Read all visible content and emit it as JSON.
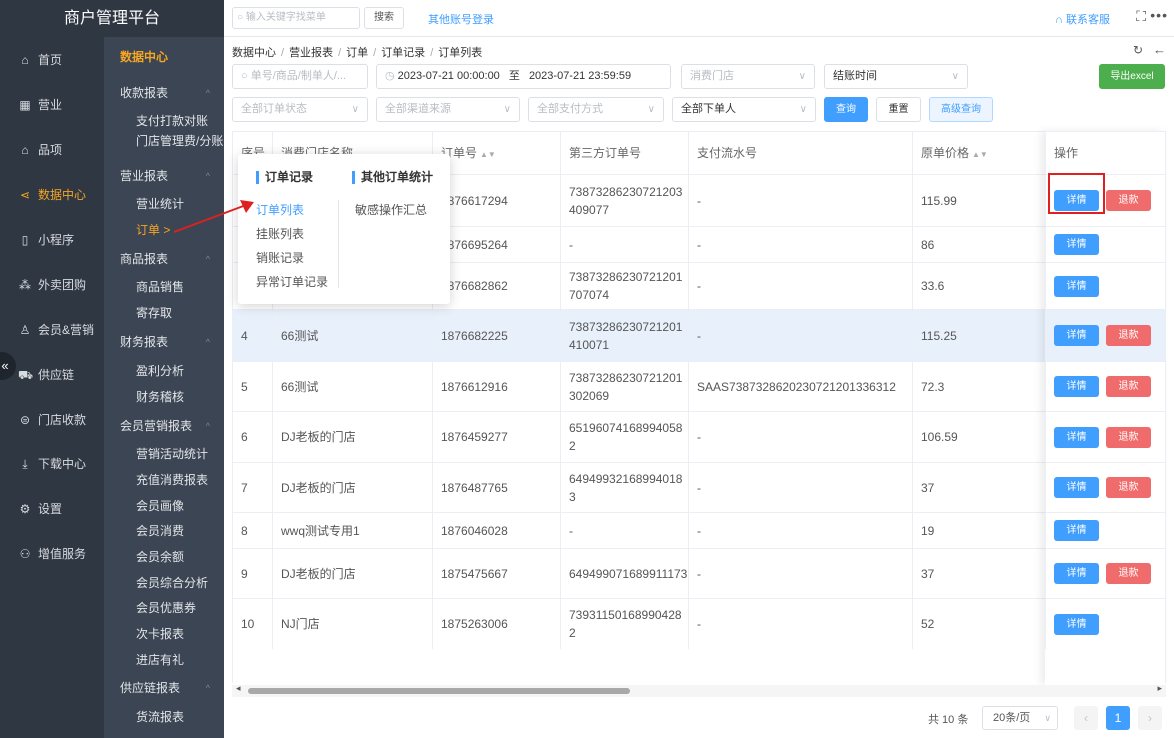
{
  "brand": "商户管理平台",
  "nav": [
    {
      "icon": "home-icon",
      "glyph": "⌂",
      "label": "首页"
    },
    {
      "icon": "calendar-icon",
      "glyph": "▦",
      "label": "营业"
    },
    {
      "icon": "bag-icon",
      "glyph": "⌂",
      "label": "品项"
    },
    {
      "icon": "share-icon",
      "glyph": "⋖",
      "label": "数据中心"
    },
    {
      "icon": "mobile-icon",
      "glyph": "▯",
      "label": "小程序"
    },
    {
      "icon": "group-icon",
      "glyph": "⁂",
      "label": "外卖团购"
    },
    {
      "icon": "user-icon",
      "glyph": "♙",
      "label": "会员&营销"
    },
    {
      "icon": "truck-icon",
      "glyph": "⛟",
      "label": "供应链"
    },
    {
      "icon": "wallet-icon",
      "glyph": "⊜",
      "label": "门店收款"
    },
    {
      "icon": "download-icon",
      "glyph": "⤓",
      "label": "下载中心"
    },
    {
      "icon": "gear-icon",
      "glyph": "⚙",
      "label": "设置"
    },
    {
      "icon": "service-icon",
      "glyph": "⚇",
      "label": "增值服务"
    }
  ],
  "collapse_glyph": "«",
  "sub_nav": {
    "title": "数据中心",
    "groups": [
      {
        "label": "收款报表",
        "items": [
          "支付打款对账",
          "门店管理费/分账"
        ]
      },
      {
        "label": "营业报表",
        "items": [
          "营业统计",
          "订单 >"
        ]
      },
      {
        "label": "商品报表",
        "items": [
          "商品销售",
          "寄存取"
        ]
      },
      {
        "label": "财务报表",
        "items": [
          "盈利分析",
          "财务稽核"
        ]
      },
      {
        "label": "会员营销报表",
        "items": [
          "营销活动统计",
          "充值消费报表",
          "会员画像",
          "会员消费",
          "会员余额",
          "会员综合分析",
          "会员优惠券",
          "次卡报表",
          "进店有礼"
        ]
      },
      {
        "label": "供应链报表",
        "items": [
          "货流报表"
        ]
      }
    ]
  },
  "topbar": {
    "search_placeholder": "输入关键字找菜单",
    "search_button": "搜索",
    "other_login": "其他账号登录",
    "contact": "联系客服",
    "fullscreen": "⛶",
    "more": "•••"
  },
  "breadcrumb": [
    "数据中心",
    "营业报表",
    "订单",
    "订单记录",
    "订单列表"
  ],
  "filters": {
    "order_search": "单号/商品/制单人/...",
    "date_start": "2023-07-21 00:00:00",
    "date_to": "至",
    "date_end": "2023-07-21 23:59:59",
    "store": "消费门店",
    "checkout_time": "结账时间",
    "order_status": "全部订单状态",
    "channel": "全部渠道来源",
    "payment": "全部支付方式",
    "creator": "全部下单人",
    "query": "查询",
    "reset": "重置",
    "advanced": "高级查询",
    "export": "导出excel"
  },
  "table": {
    "columns": [
      "序号",
      "消费门店名称",
      "订单号",
      "第三方订单号",
      "支付流水号",
      "原单价格",
      "操作"
    ],
    "rows": [
      {
        "no": "1",
        "store": "",
        "order": "1876617294",
        "third": "73873286230721203\n409077",
        "serial": "-",
        "price": "115.99",
        "refund": true
      },
      {
        "no": "2",
        "store": "",
        "order": "1876695264",
        "third": "-",
        "serial": "-",
        "price": "86",
        "refund": false
      },
      {
        "no": "3",
        "store": "",
        "order": "1876682862",
        "third": "73873286230721201\n707074",
        "serial": "-",
        "price": "33.6",
        "refund": false
      },
      {
        "no": "4",
        "store": "66测试",
        "order": "1876682225",
        "third": "73873286230721201\n410071",
        "serial": "-",
        "price": "115.25",
        "refund": true
      },
      {
        "no": "5",
        "store": "66测试",
        "order": "1876612916",
        "third": "73873286230721201\n302069",
        "serial": "SAAS7387328620230721201336312",
        "price": "72.3",
        "refund": true
      },
      {
        "no": "6",
        "store": "DJ老板的门店",
        "order": "1876459277",
        "third": "65196074168994058\n2",
        "serial": "-",
        "price": "106.59",
        "refund": true
      },
      {
        "no": "7",
        "store": "DJ老板的门店",
        "order": "1876487765",
        "third": "64949932168994018\n3",
        "serial": "-",
        "price": "37",
        "refund": true
      },
      {
        "no": "8",
        "store": "wwq测试专用1",
        "order": "1876046028",
        "third": "-",
        "serial": "-",
        "price": "19",
        "refund": false
      },
      {
        "no": "9",
        "store": "DJ老板的门店",
        "order": "1875475667",
        "third": "649499071689911173",
        "serial": "-",
        "price": "37",
        "refund": true
      },
      {
        "no": "10",
        "store": "NJ门店",
        "order": "1875263006",
        "third": "73931150168990428\n2",
        "serial": "-",
        "price": "52",
        "refund": false
      }
    ],
    "detail_label": "详情",
    "refund_label": "退款"
  },
  "pagination": {
    "total": "共 10 条",
    "page_size": "20条/页",
    "current": "1",
    "prev": "‹",
    "next": "›"
  },
  "popover": {
    "col1_title": "订单记录",
    "col1_items": [
      "订单列表",
      "挂账列表",
      "销账记录",
      "异常订单记录"
    ],
    "col2_title": "其他订单统计",
    "col2_items": [
      "敏感操作汇总"
    ]
  },
  "colors": {
    "primary": "#409eff",
    "danger": "#f06b6b",
    "accent": "#f5a623",
    "sidebar": "#2f3743",
    "export": "#4cae4c",
    "annotation": "#e02020"
  }
}
